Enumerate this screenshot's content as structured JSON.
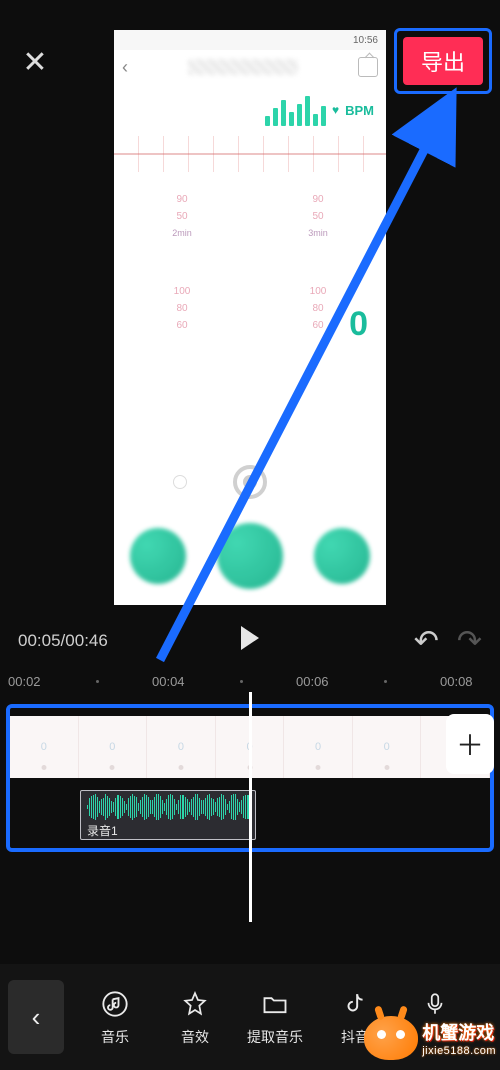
{
  "topbar": {
    "close": "✕",
    "export": "导出"
  },
  "preview": {
    "status_left": "   ",
    "status_right": "10:56",
    "bpm_label": "BPM",
    "big_number": "0",
    "grid_vals": [
      "90",
      "90",
      "50",
      "50"
    ],
    "time_labels": [
      "2min",
      "3min"
    ],
    "grid2_vals": [
      "100",
      "100",
      "80",
      "80",
      "60",
      "60"
    ]
  },
  "playback": {
    "current": "00:05",
    "total": "00:46"
  },
  "ruler": [
    "00:02",
    "00:04",
    "00:06",
    "00:08"
  ],
  "timeline": {
    "track_label": "录音1",
    "seg_char": "0"
  },
  "bottom": {
    "items": [
      {
        "icon": "music",
        "label": "音乐"
      },
      {
        "icon": "star",
        "label": "音效"
      },
      {
        "icon": "folder",
        "label": "提取音乐"
      },
      {
        "icon": "douyin",
        "label": "抖音"
      },
      {
        "icon": "mic",
        "label": ""
      }
    ]
  },
  "watermark": {
    "title": "机蟹游戏",
    "url": "jixie5188.com"
  }
}
